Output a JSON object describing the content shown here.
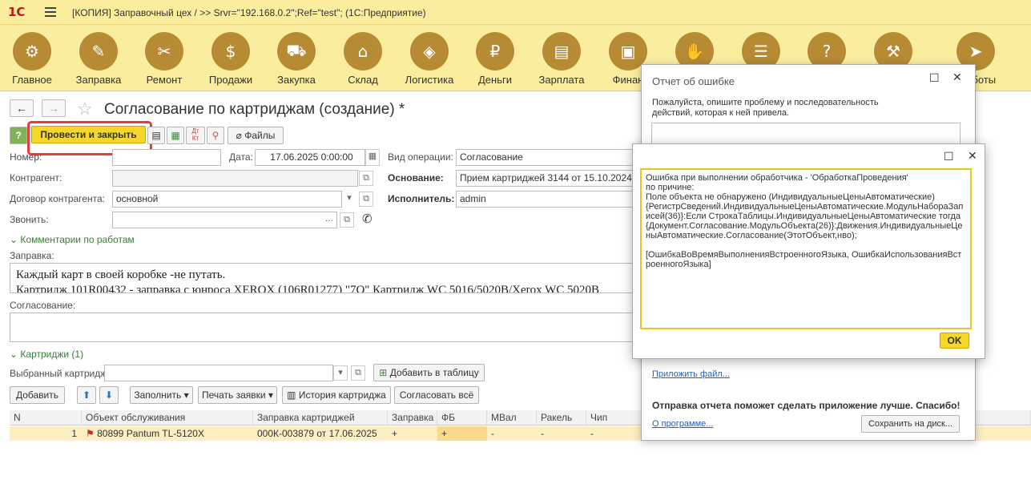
{
  "titlebar": {
    "logo": "1С",
    "title": "[КОПИЯ] Заправочный цех /  >> Srvr=\"192.168.0.2\";Ref=\"test\";  (1С:Предприятие)"
  },
  "sections": [
    {
      "label": "Главное",
      "icon": "gears-icon",
      "glyph": "⚙"
    },
    {
      "label": "Заправка",
      "icon": "refill-icon",
      "glyph": "✎"
    },
    {
      "label": "Ремонт",
      "icon": "tools-icon",
      "glyph": "✂"
    },
    {
      "label": "Продажи",
      "icon": "sale-icon",
      "glyph": "$"
    },
    {
      "label": "Закупка",
      "icon": "cart-icon",
      "glyph": "⛟"
    },
    {
      "label": "Склад",
      "icon": "warehouse-icon",
      "glyph": "⌂"
    },
    {
      "label": "Логистика",
      "icon": "route-icon",
      "glyph": "◈"
    },
    {
      "label": "Деньги",
      "icon": "money-bag-icon",
      "glyph": "₽"
    },
    {
      "label": "Зарплата",
      "icon": "wallet-icon",
      "glyph": "▤"
    },
    {
      "label": "Финан",
      "icon": "finance-icon",
      "glyph": "▣"
    },
    {
      "label": "",
      "icon": "hand-money-icon",
      "glyph": "✋"
    },
    {
      "label": "",
      "icon": "checklist-icon",
      "glyph": "☰"
    },
    {
      "label": "",
      "icon": "help-book-icon",
      "glyph": "?"
    },
    {
      "label": "",
      "icon": "pipette-icon",
      "glyph": "⚒"
    },
    {
      "label": "ам-боты",
      "icon": "telegram-icon",
      "glyph": "➤"
    }
  ],
  "form": {
    "title": "Согласование по картриджам (создание) *",
    "post_close": "Провести и закрыть",
    "files": "Файлы",
    "number_label": "Номер:",
    "number_value": "",
    "date_label": "Дата:",
    "date_value": "17.06.2025  0:00:00",
    "op_label": "Вид операции:",
    "op_value": "Согласование",
    "counterparty_label": "Контрагент:",
    "counterparty_value": "",
    "basis_label": "Основание:",
    "basis_value": "Прием картриджей 3144 от 15.10.2024",
    "contract_label": "Договор контрагента:",
    "contract_value": "основной",
    "executor_label": "Исполнитель:",
    "executor_value": "admin",
    "call_label": "Звонить:",
    "call_value": "",
    "comments_group": "Комментарии по работам",
    "refill_label": "Заправка:",
    "refill_lines": [
      "Каждый карт в своей коробке -не путать.",
      "Картридж 101R00432 - заправка с юнроса XEROX (106R01277) \"7О\" Картридж WC 5016/5020B/Xerox WC 5020B"
    ],
    "agree_label": "Согласование:",
    "cartridges_group": "Картриджи (1)",
    "selected_label": "Выбранный картридж:",
    "selected_value": "",
    "add_to_table": "Добавить в таблицу",
    "buttons": {
      "add": "Добавить",
      "fill": "Заполнить",
      "print_requests": "Печать заявки",
      "history": "История картриджа",
      "agree_all": "Согласовать всё"
    }
  },
  "table": {
    "columns": [
      "N",
      "Объект обслуживания",
      "Заправка картриджей",
      "Заправка",
      "ФБ",
      "МВал",
      "Ракель",
      "Чип"
    ],
    "rows": [
      {
        "n": "1",
        "object": "80899 Pantum TL-5120X",
        "refill_doc": "000К-003879 от 17.06.2025",
        "refill": "+",
        "fb": "+",
        "mval": "-",
        "rakel": "-",
        "chip": "-"
      }
    ]
  },
  "report_dialog": {
    "title": "Отчет об ошибке",
    "prompt": "Пожалуйста, опишите проблему и последовательность действий, которая к ней привела.",
    "attach_file": "Приложить файл...",
    "thanks": "Отправка отчета поможет сделать приложение лучше. Спасибо!",
    "about": "О программе...",
    "save_to_disk": "Сохранить на диск..."
  },
  "error_dialog": {
    "message": "Ошибка при выполнении обработчика - 'ОбработкаПроведения'\nпо причине:\nПоле объекта не обнаружено (ИндивидуальныеЦеныАвтоматические)\n{РегистрСведений.ИндивидуальныеЦеныАвтоматические.МодульНабораЗаписей(36)}:Если СтрокаТаблицы.ИндивидуальныеЦеныАвтоматические тогда\n{Документ.Согласование.МодульОбъекта(26)}:Движения.ИндивидуальныеЦеныАвтоматические.Согласование(ЭтотОбъект,нво);\n\n[ОшибкаВоВремяВыполненияВстроенногоЯзыка, ОшибкаИспользованияВстроенногоЯзыка]",
    "ok": "OK"
  }
}
